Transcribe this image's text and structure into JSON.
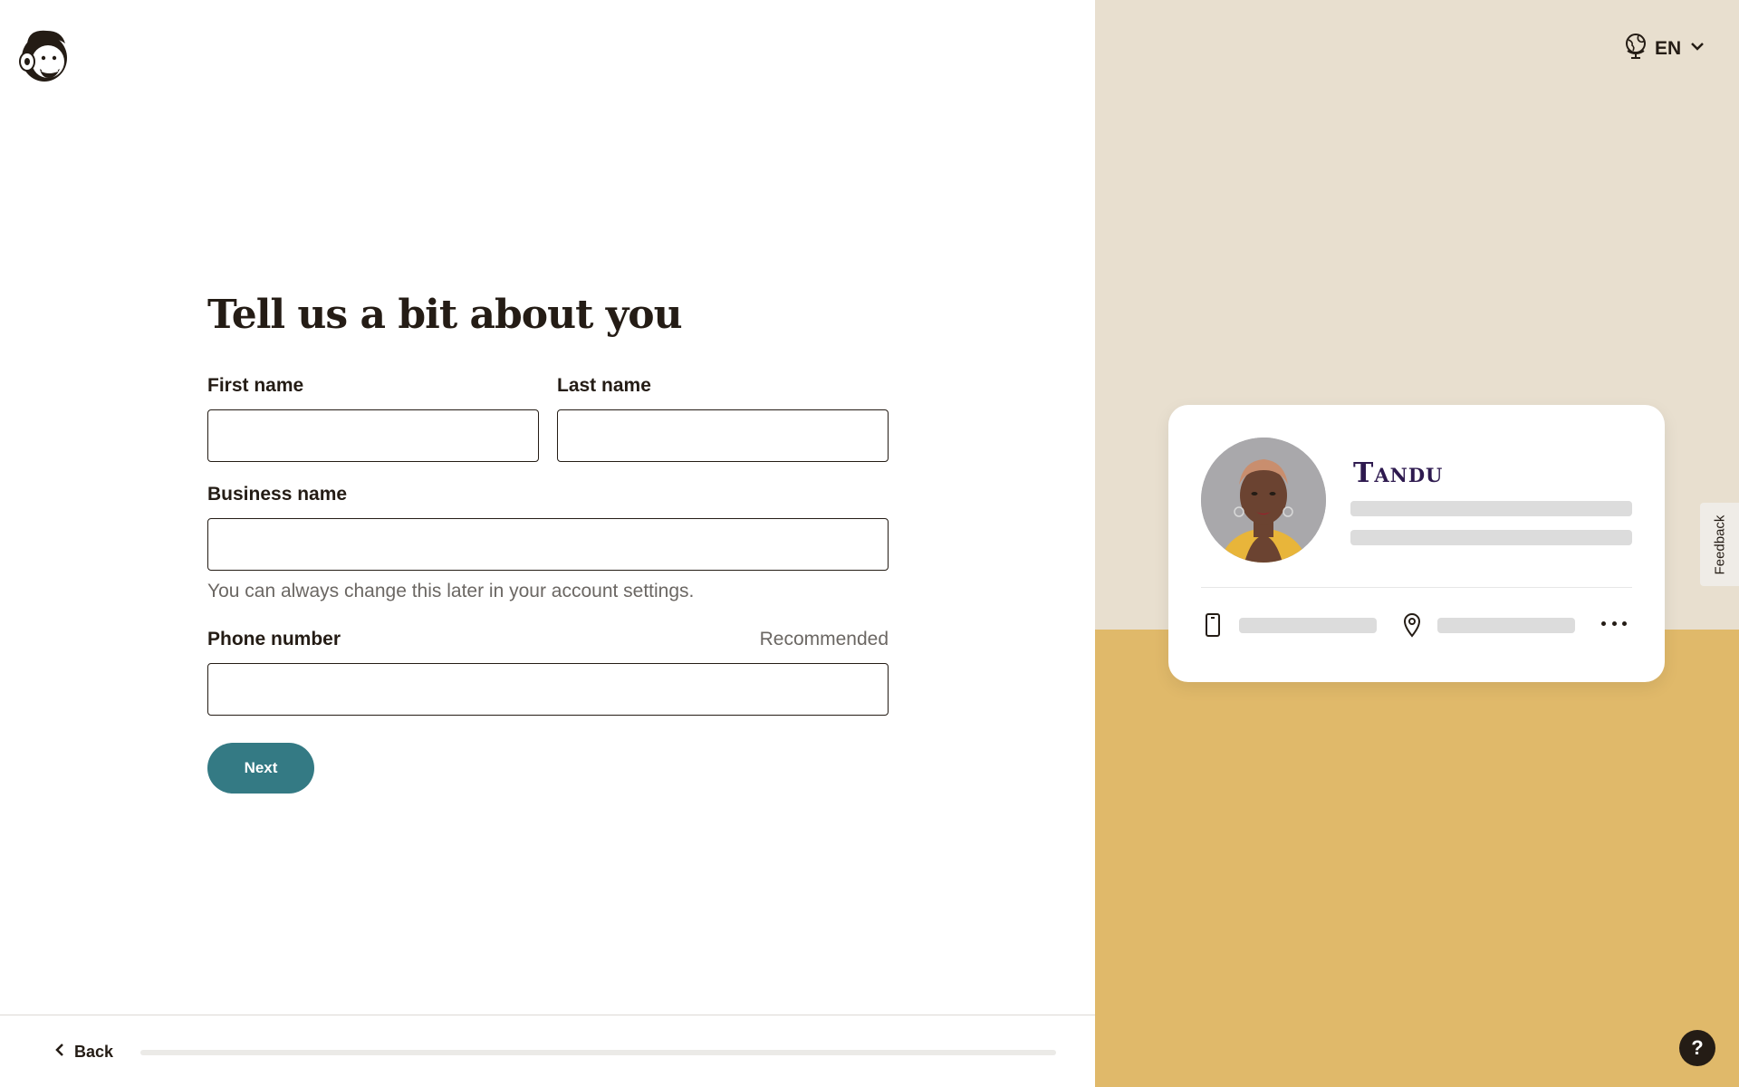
{
  "form": {
    "title": "Tell us a bit about you",
    "first_name_label": "First name",
    "first_name_value": "",
    "last_name_label": "Last name",
    "last_name_value": "",
    "business_name_label": "Business name",
    "business_name_value": "",
    "business_helper": "You can always change this later in your account settings.",
    "phone_label": "Phone number",
    "phone_value": "",
    "phone_hint": "Recommended",
    "next_label": "Next"
  },
  "footer": {
    "back_label": "Back",
    "progress_fraction": 0
  },
  "language": {
    "selected": "EN",
    "icon": "globe-icon"
  },
  "preview_card": {
    "brand_name": "Tandu",
    "icons": [
      "phone-icon",
      "location-pin-icon",
      "more-horizontal-icon"
    ]
  },
  "feedback_tab": {
    "label": "Feedback"
  },
  "help_button": {
    "label": "?"
  },
  "colors": {
    "primary_button": "#347a84",
    "right_panel_top": "#e8dfcf",
    "right_panel_bottom": "#e0b96a",
    "brand_text": "#2e1a4f"
  }
}
